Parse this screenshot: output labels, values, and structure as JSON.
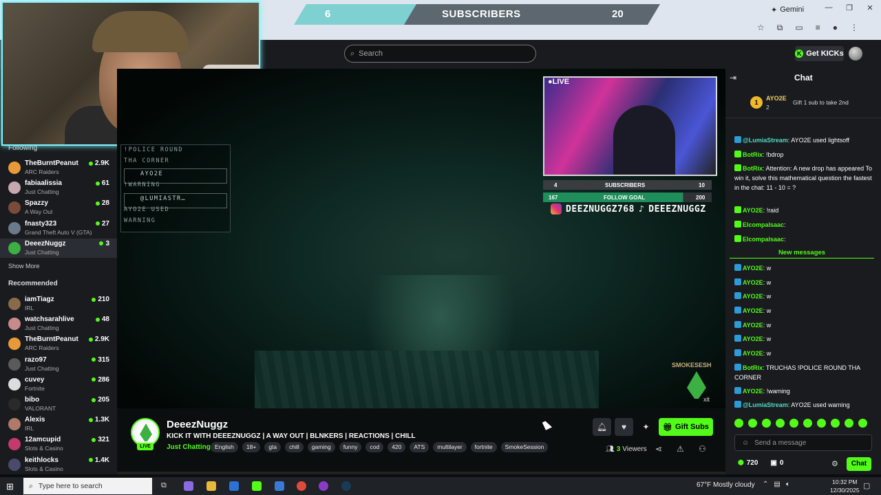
{
  "browser": {
    "gemini_label": "Gemini",
    "window_controls": [
      "—",
      "❐",
      "✕"
    ]
  },
  "subscriber_bar": {
    "current": "6",
    "label": "SUBSCRIBERS",
    "goal": "20"
  },
  "header": {
    "search_placeholder": "Search",
    "get_kicks_label": "Get KICKs"
  },
  "sidebar": {
    "following_title": "Following",
    "following": [
      {
        "name": "TheBurntPeanut",
        "category": "ARC Raiders",
        "viewers": "2.9K",
        "color": "#e89a3a"
      },
      {
        "name": "fabiaalissia",
        "category": "Just Chatting",
        "viewers": "61",
        "color": "#c7a7b0"
      },
      {
        "name": "Spazzy",
        "category": "A Way Out",
        "viewers": "28",
        "color": "#7a4a3a"
      },
      {
        "name": "fnasty323",
        "category": "Grand Theft Auto V (GTA)",
        "viewers": "27",
        "color": "#6a7a8a"
      },
      {
        "name": "DeeezNuggz",
        "category": "Just Chatting",
        "viewers": "3",
        "color": "#3cb042"
      }
    ],
    "show_more": "Show More",
    "recommended_title": "Recommended",
    "recommended": [
      {
        "name": "iamTiagz",
        "category": "IRL",
        "viewers": "210",
        "color": "#8a6a4a"
      },
      {
        "name": "watchsarahlive",
        "category": "Just Chatting",
        "viewers": "48",
        "color": "#c98a8a"
      },
      {
        "name": "TheBurntPeanut",
        "category": "ARC Raiders",
        "viewers": "2.9K",
        "color": "#e89a3a"
      },
      {
        "name": "razo97",
        "category": "Just Chatting",
        "viewers": "315",
        "color": "#5a5a5a"
      },
      {
        "name": "cuvey",
        "category": "Fortnite",
        "viewers": "286",
        "color": "#dddddd"
      },
      {
        "name": "bibo",
        "category": "VALORANT",
        "viewers": "205",
        "color": "#2a2a2a"
      },
      {
        "name": "Alexis",
        "category": "IRL",
        "viewers": "1.3K",
        "color": "#b07a6a"
      },
      {
        "name": "12amcupid",
        "category": "Slots & Casino",
        "viewers": "321",
        "color": "#c43a6a"
      },
      {
        "name": "keithlocks",
        "category": "Slots & Casino",
        "viewers": "1.4K",
        "color": "#4a4a6a"
      }
    ]
  },
  "video_overlay": {
    "chat_lines": [
      "!POLICE ROUND",
      "THA CORNER",
      "AYO2E",
      "!WARNING",
      "@LUMIASTR…",
      "AYO2E USED",
      "WARNING"
    ],
    "live_label": "●LIVE",
    "bar_subs_current": "4",
    "bar_subs_label": "SUBSCRIBERS",
    "bar_subs_goal": "10",
    "bar_follow_current": "167",
    "bar_follow_label": "FOLLOW GOAL",
    "bar_follow_goal": "200",
    "instagram": "DEEZNUGGZ768",
    "tiktok": "DEEEZNUGGZ",
    "logo_text": "SMOKESESH",
    "exit_label": "xit"
  },
  "stream": {
    "channel": "DeeezNuggz",
    "live_badge": "LIVE",
    "title": "KICK IT WITH DEEEZNUGGZ | A WAY OUT | BLNKERS | REACTIONS | CHILL",
    "category": "Just Chatting",
    "tags": [
      "English",
      "18+",
      "gta",
      "chill",
      "gaming",
      "funny",
      "cod",
      "420",
      "ATS",
      "multilayer",
      "fortnite",
      "SmokeSession"
    ],
    "gift_label": "Gift Subs",
    "viewers_count": "3",
    "viewers_label": "Viewers"
  },
  "chat": {
    "title": "Chat",
    "pinned": {
      "rank": "1",
      "user": "AYO2E",
      "count": "2",
      "gift_text": "Gift 1 sub to take 2nd"
    },
    "messages": [
      {
        "user": "@LumiaStream",
        "text": ": AYO2E used lightsoff",
        "badge": "blue"
      },
      {
        "user": "BotRix",
        "text": ": !bdrop",
        "badge": "green"
      },
      {
        "user": "BotRix",
        "text": ": Attention: A new drop has appeared To win it, solve this mathematical question the fastest in the chat: 11 - 10 = ?",
        "badge": "green"
      },
      {
        "user": "AYO2E",
        "text": ": !raid",
        "badge": "green"
      },
      {
        "user": "Elcompalsaac",
        "text": ":",
        "badge": "green"
      },
      {
        "user": "Elcompalsaac",
        "text": ":",
        "badge": "green"
      }
    ],
    "new_messages_label": "New messages",
    "after": [
      {
        "user": "AYO2E",
        "text": ": w"
      },
      {
        "user": "AYO2E",
        "text": ": w"
      },
      {
        "user": "AYO2E",
        "text": ": w"
      },
      {
        "user": "AYO2E",
        "text": ": w"
      },
      {
        "user": "AYO2E",
        "text": ": w"
      },
      {
        "user": "AYO2E",
        "text": ": w"
      },
      {
        "user": "AYO2E",
        "text": ": w"
      },
      {
        "user": "BotRix",
        "text": ": TRUCHAS !POLICE ROUND THA CORNER"
      },
      {
        "user": "AYO2E",
        "text": ": !warning"
      },
      {
        "user": "@LumiaStream",
        "text": ": AYO2E used warning"
      }
    ],
    "input_placeholder": "Send a message",
    "kicks": "720",
    "zero": "0",
    "send_label": "Chat"
  },
  "taskbar": {
    "search_placeholder": "Type here to search",
    "weather": "67°F  Mostly cloudy",
    "time": "10:32 PM",
    "date": "12/30/2025"
  }
}
